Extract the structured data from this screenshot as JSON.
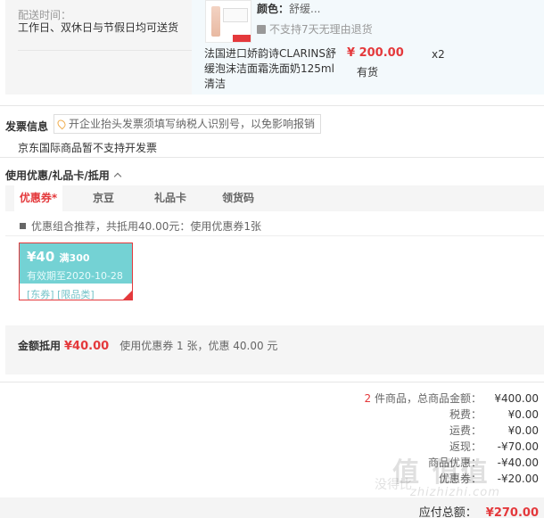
{
  "delivery": {
    "label": "配送时间：",
    "value": "工作日、双休日与节假日均可送货"
  },
  "product": {
    "color_label": "颜色：",
    "color_value": "舒缓...",
    "no_return": "不支持7天无理由退货",
    "name": "法国进口娇韵诗CLARINS舒缓泡沫洁面霜洗面奶125ml清洁",
    "price": "¥ 200.00",
    "stock": "有货",
    "quantity": "x2"
  },
  "invoice": {
    "title": "发票信息",
    "tip": "开企业抬头发票须填写纳税人识别号，以免影响报销",
    "note": "京东国际商品暂不支持开发票"
  },
  "coupons": {
    "title": "使用优惠/礼品卡/抵用",
    "tabs": [
      {
        "label": "优惠券*"
      },
      {
        "label": "京豆"
      },
      {
        "label": "礼品卡"
      },
      {
        "label": "领货码"
      }
    ],
    "combo_text": "优惠组合推荐，共抵用40.00元：使用优惠券1张",
    "coupon": {
      "amount": "¥40",
      "threshold": "满300",
      "expiry": "有效期至2020-10-28",
      "limit": "[东券] [限品类]"
    },
    "summary_label": "金额抵用",
    "summary_amount": "¥40.00",
    "summary_desc": "使用优惠券 1 张，优惠 40.00 元"
  },
  "totals": {
    "count": "2",
    "goods_label": "件商品，总商品金额：",
    "goods_value": "¥400.00",
    "tax_label": "税费：",
    "tax_value": "¥0.00",
    "ship_label": "运费：",
    "ship_value": "¥0.00",
    "cashback_label": "返现：",
    "cashback_value": "-¥70.00",
    "row5_label": "商品优惠：",
    "row5_value": "-¥40.00",
    "row6_label": "优惠券：",
    "row6_value": "-¥20.00",
    "final_label": "应付总额：",
    "final_value": "¥270.00"
  },
  "watermark": {
    "big": "值 值值",
    "small": "zhizhizhi.com",
    "cn": "没得比"
  },
  "colors": {
    "accent": "#e4393c",
    "coupon_teal": "#74d2d4"
  }
}
